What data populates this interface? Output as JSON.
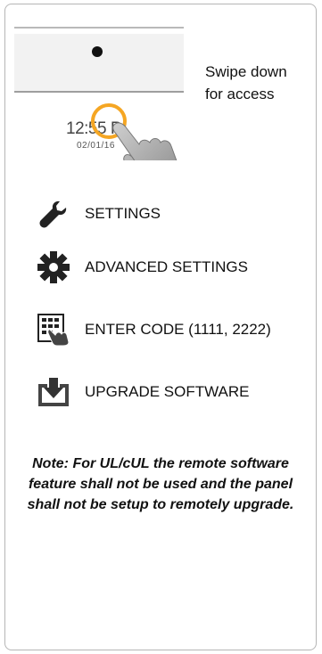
{
  "illustration": {
    "time": "12:55 P",
    "date": "02/01/16",
    "instruction_line1": "Swipe down",
    "instruction_line2": "for access"
  },
  "menu": {
    "items": [
      {
        "label": "SETTINGS",
        "icon": "wrench-icon"
      },
      {
        "label": "ADVANCED SETTINGS",
        "icon": "gear-icon"
      },
      {
        "label": "ENTER CODE (1111, 2222)",
        "icon": "keypad-hand-icon"
      },
      {
        "label": "UPGRADE SOFTWARE",
        "icon": "download-box-icon"
      }
    ]
  },
  "note": "Note: For UL/cUL the remote software feature shall not be used and the panel shall not be setup to remotely upgrade.",
  "colors": {
    "accent_ring": "#f5a623",
    "icon": "#222222"
  }
}
